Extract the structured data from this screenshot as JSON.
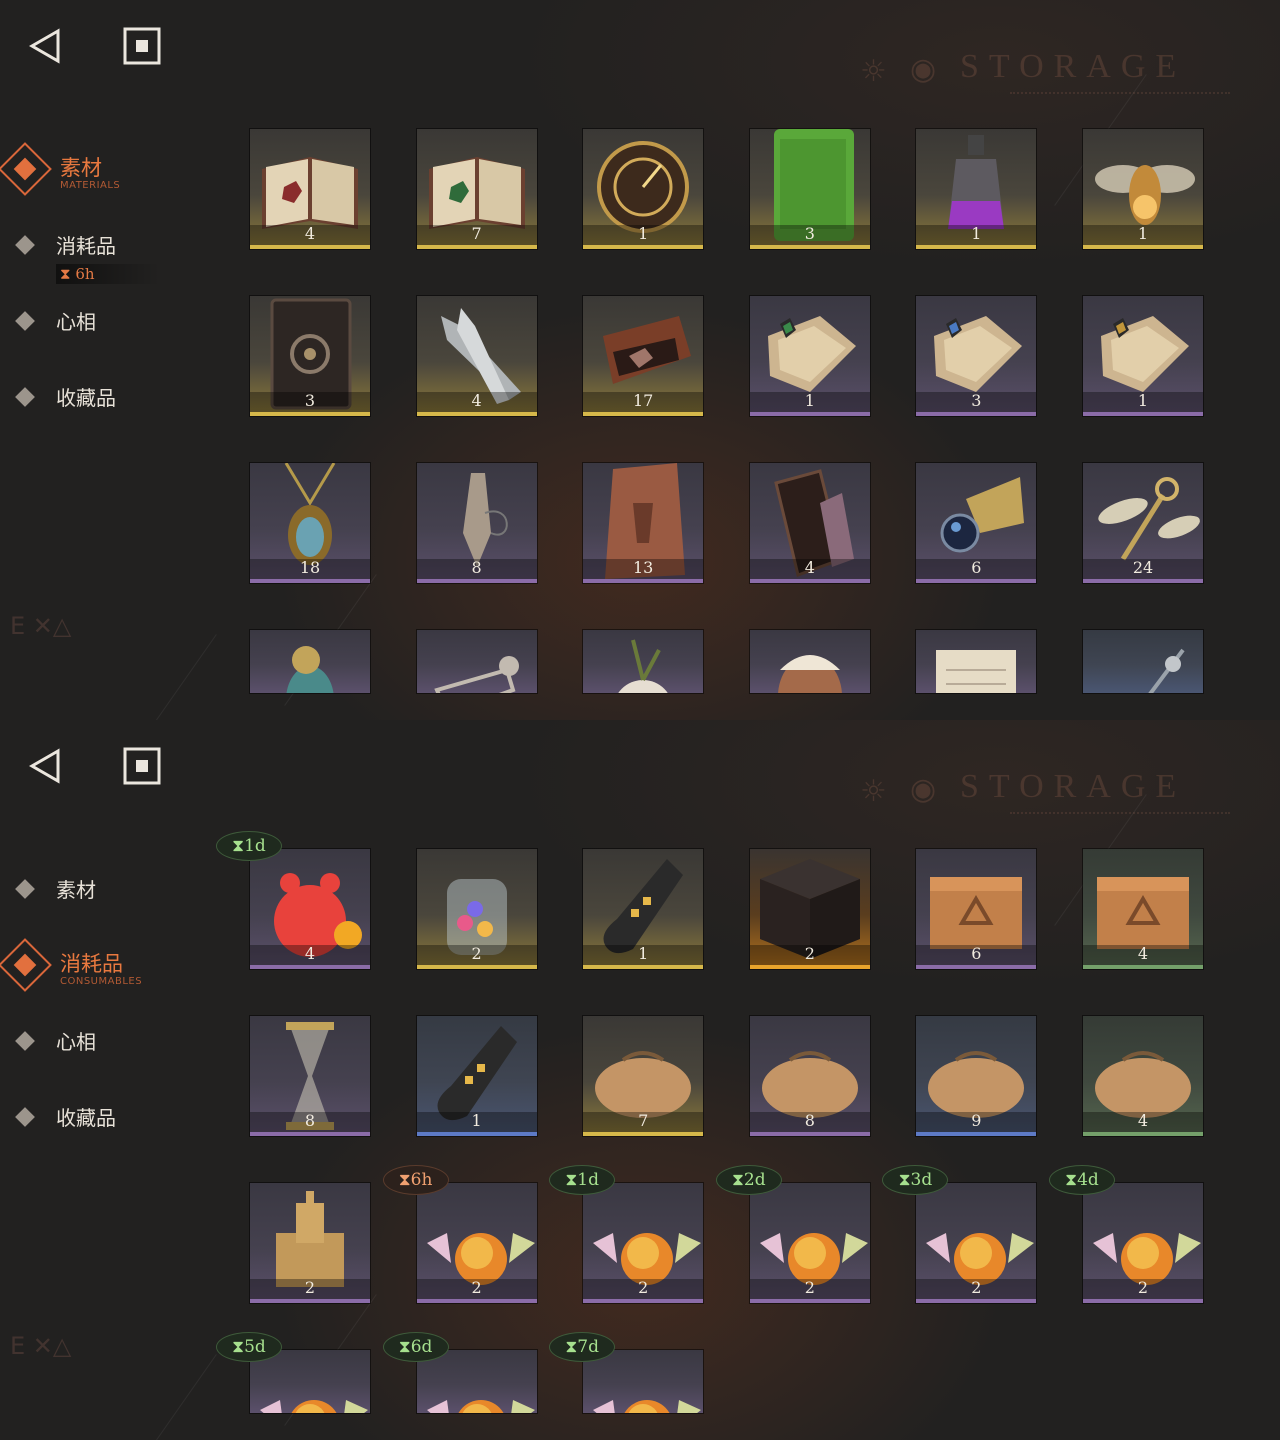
{
  "title": "STORAGE",
  "panels": [
    {
      "nav": {
        "items": [
          {
            "label": "素材",
            "sub": "MATERIALS",
            "active": true
          },
          {
            "label": "消耗品",
            "timer": "6h"
          },
          {
            "label": "心相"
          },
          {
            "label": "收藏品"
          }
        ]
      },
      "items": [
        {
          "icon": "red-book",
          "count": "4",
          "rarity": "gold"
        },
        {
          "icon": "green-book",
          "count": "7",
          "rarity": "gold"
        },
        {
          "icon": "astrolabe",
          "count": "1",
          "rarity": "gold"
        },
        {
          "icon": "green-tablet",
          "count": "3",
          "rarity": "gold"
        },
        {
          "icon": "potion-bottle",
          "count": "1",
          "rarity": "gold"
        },
        {
          "icon": "firefly",
          "count": "1",
          "rarity": "gold"
        },
        {
          "icon": "dark-tome",
          "count": "3",
          "rarity": "gold"
        },
        {
          "icon": "bullets",
          "count": "4",
          "rarity": "gold"
        },
        {
          "icon": "hand-box",
          "count": "17",
          "rarity": "gold"
        },
        {
          "icon": "green-scroll",
          "count": "1",
          "rarity": "purple"
        },
        {
          "icon": "blue-scroll",
          "count": "3",
          "rarity": "purple"
        },
        {
          "icon": "gold-scroll",
          "count": "1",
          "rarity": "purple"
        },
        {
          "icon": "amulet",
          "count": "18",
          "rarity": "purple"
        },
        {
          "icon": "pendulum",
          "count": "8",
          "rarity": "purple"
        },
        {
          "icon": "stone-tablet",
          "count": "13",
          "rarity": "purple"
        },
        {
          "icon": "coffin-case",
          "count": "4",
          "rarity": "purple"
        },
        {
          "icon": "orb-gauge",
          "count": "6",
          "rarity": "purple"
        },
        {
          "icon": "winged-key",
          "count": "24",
          "rarity": "purple"
        },
        {
          "icon": "bird-figurine",
          "count": "",
          "rarity": "purple"
        },
        {
          "icon": "skeleton",
          "count": "",
          "rarity": "purple"
        },
        {
          "icon": "flower-bulb",
          "count": "",
          "rarity": "purple"
        },
        {
          "icon": "mask",
          "count": "",
          "rarity": "purple"
        },
        {
          "icon": "parchment",
          "count": "",
          "rarity": "purple"
        },
        {
          "icon": "scepter",
          "count": "",
          "rarity": "blue"
        }
      ]
    },
    {
      "nav": {
        "items": [
          {
            "label": "素材"
          },
          {
            "label": "消耗品",
            "sub": "CONSUMABLES",
            "active": true
          },
          {
            "label": "心相"
          },
          {
            "label": "收藏品"
          }
        ]
      },
      "items": [
        {
          "icon": "gummy-bear",
          "count": "4",
          "rarity": "purple",
          "timer": "1d",
          "timer_color": "green"
        },
        {
          "icon": "candy-jar",
          "count": "2",
          "rarity": "gold"
        },
        {
          "icon": "message-bottle",
          "count": "1",
          "rarity": "gold"
        },
        {
          "icon": "rune-cube",
          "count": "2",
          "rarity": "orange"
        },
        {
          "icon": "wooden-crate",
          "count": "6",
          "rarity": "purple"
        },
        {
          "icon": "wooden-crate",
          "count": "4",
          "rarity": "green"
        },
        {
          "icon": "hourglass",
          "count": "8",
          "rarity": "purple"
        },
        {
          "icon": "message-bottle",
          "count": "1",
          "rarity": "blue"
        },
        {
          "icon": "parcel",
          "count": "7",
          "rarity": "gold"
        },
        {
          "icon": "parcel",
          "count": "8",
          "rarity": "purple"
        },
        {
          "icon": "parcel",
          "count": "9",
          "rarity": "blue"
        },
        {
          "icon": "parcel",
          "count": "4",
          "rarity": "green"
        },
        {
          "icon": "sand-castle",
          "count": "2",
          "rarity": "purple"
        },
        {
          "icon": "candies",
          "count": "2",
          "rarity": "purple",
          "timer": "6h",
          "timer_color": "orange"
        },
        {
          "icon": "candies",
          "count": "2",
          "rarity": "purple",
          "timer": "1d",
          "timer_color": "green"
        },
        {
          "icon": "candies",
          "count": "2",
          "rarity": "purple",
          "timer": "2d",
          "timer_color": "green"
        },
        {
          "icon": "candies",
          "count": "2",
          "rarity": "purple",
          "timer": "3d",
          "timer_color": "green"
        },
        {
          "icon": "candies",
          "count": "2",
          "rarity": "purple",
          "timer": "4d",
          "timer_color": "green"
        },
        {
          "icon": "candies",
          "count": "",
          "rarity": "purple",
          "timer": "5d",
          "timer_color": "green"
        },
        {
          "icon": "candies",
          "count": "",
          "rarity": "purple",
          "timer": "6d",
          "timer_color": "green"
        },
        {
          "icon": "candies",
          "count": "",
          "rarity": "purple",
          "timer": "7d",
          "timer_color": "green"
        }
      ]
    }
  ]
}
